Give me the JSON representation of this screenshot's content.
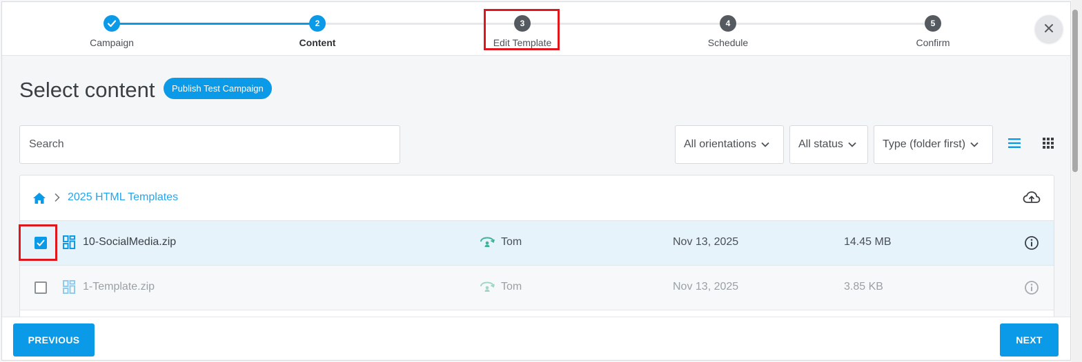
{
  "stepper": {
    "steps": [
      {
        "number": "1",
        "label": "Campaign",
        "state": "done"
      },
      {
        "number": "2",
        "label": "Content",
        "state": "active"
      },
      {
        "number": "3",
        "label": "Edit Template",
        "state": "pending"
      },
      {
        "number": "4",
        "label": "Schedule",
        "state": "pending"
      },
      {
        "number": "5",
        "label": "Confirm",
        "state": "pending"
      }
    ]
  },
  "close_icon": "close-icon",
  "page": {
    "title": "Select content",
    "publish_test_label": "Publish Test Campaign"
  },
  "filters": {
    "search_placeholder": "Search",
    "orientation": "All orientations",
    "status": "All status",
    "sort": "Type (folder first)"
  },
  "breadcrumb": {
    "folder": "2025 HTML Templates"
  },
  "files": [
    {
      "name": "10-SocialMedia.zip",
      "owner": "Tom",
      "date": "Nov 13, 2025",
      "size": "14.45 MB",
      "checked": true
    },
    {
      "name": "1-Template.zip",
      "owner": "Tom",
      "date": "Nov 13, 2025",
      "size": "3.85 KB",
      "checked": false
    }
  ],
  "footer": {
    "previous_label": "PREVIOUS",
    "next_label": "NEXT"
  },
  "colors": {
    "accent": "#0a9ae8",
    "highlight": "#e0161d",
    "owner_icon": "#3fb39a"
  }
}
